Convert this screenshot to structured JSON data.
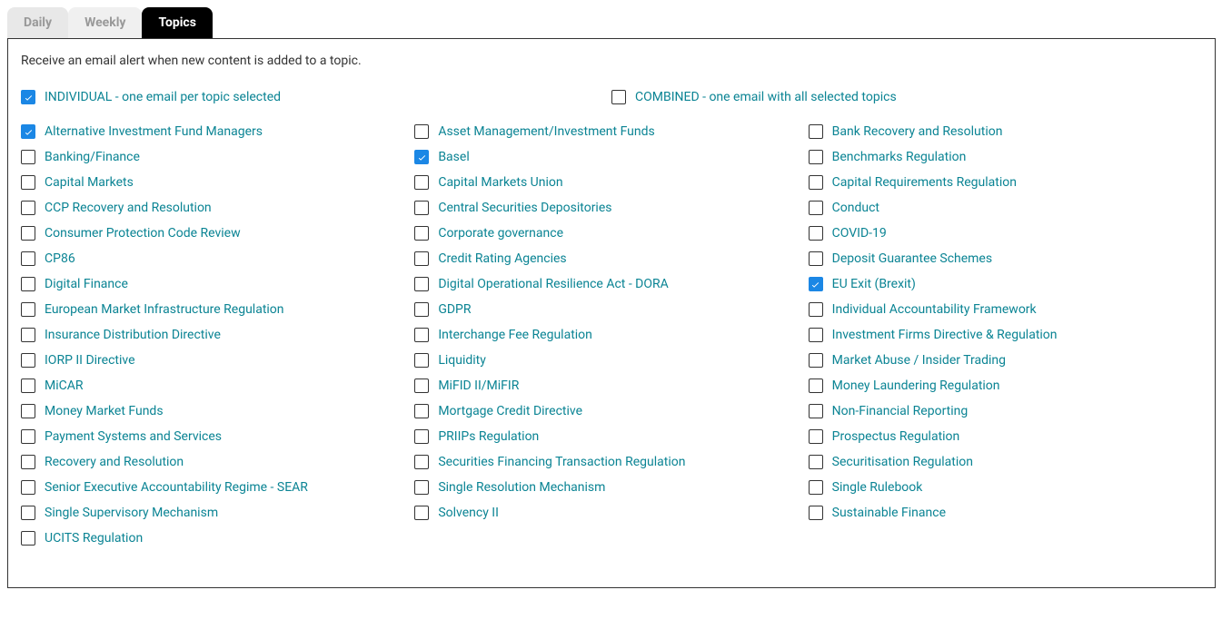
{
  "tabs": {
    "daily": "Daily",
    "weekly": "Weekly",
    "topics": "Topics"
  },
  "intro": "Receive an email alert when new content is added to a topic.",
  "modes": {
    "individual": {
      "label": "INDIVIDUAL - one email per topic selected",
      "checked": true
    },
    "combined": {
      "label": "COMBINED - one email with all selected topics",
      "checked": false
    }
  },
  "topics": [
    {
      "label": "Alternative Investment Fund Managers",
      "checked": true
    },
    {
      "label": "Asset Management/Investment Funds",
      "checked": false
    },
    {
      "label": "Bank Recovery and Resolution",
      "checked": false
    },
    {
      "label": "Banking/Finance",
      "checked": false
    },
    {
      "label": "Basel",
      "checked": true
    },
    {
      "label": "Benchmarks Regulation",
      "checked": false
    },
    {
      "label": "Capital Markets",
      "checked": false
    },
    {
      "label": "Capital Markets Union",
      "checked": false
    },
    {
      "label": "Capital Requirements Regulation",
      "checked": false
    },
    {
      "label": "CCP Recovery and Resolution",
      "checked": false
    },
    {
      "label": "Central Securities Depositories",
      "checked": false
    },
    {
      "label": "Conduct",
      "checked": false
    },
    {
      "label": "Consumer Protection Code Review",
      "checked": false
    },
    {
      "label": "Corporate governance",
      "checked": false
    },
    {
      "label": "COVID-19",
      "checked": false
    },
    {
      "label": "CP86",
      "checked": false
    },
    {
      "label": "Credit Rating Agencies",
      "checked": false
    },
    {
      "label": "Deposit Guarantee Schemes",
      "checked": false
    },
    {
      "label": "Digital Finance",
      "checked": false
    },
    {
      "label": "Digital Operational Resilience Act - DORA",
      "checked": false
    },
    {
      "label": "EU Exit (Brexit)",
      "checked": true
    },
    {
      "label": "European Market Infrastructure Regulation",
      "checked": false
    },
    {
      "label": "GDPR",
      "checked": false
    },
    {
      "label": "Individual Accountability Framework",
      "checked": false
    },
    {
      "label": "Insurance Distribution Directive",
      "checked": false
    },
    {
      "label": "Interchange Fee Regulation",
      "checked": false
    },
    {
      "label": "Investment Firms Directive & Regulation",
      "checked": false
    },
    {
      "label": "IORP II Directive",
      "checked": false
    },
    {
      "label": "Liquidity",
      "checked": false
    },
    {
      "label": "Market Abuse / Insider Trading",
      "checked": false
    },
    {
      "label": "MiCAR",
      "checked": false
    },
    {
      "label": "MiFID II/MiFIR",
      "checked": false
    },
    {
      "label": "Money Laundering Regulation",
      "checked": false
    },
    {
      "label": "Money Market Funds",
      "checked": false
    },
    {
      "label": "Mortgage Credit Directive",
      "checked": false
    },
    {
      "label": "Non-Financial Reporting",
      "checked": false
    },
    {
      "label": "Payment Systems and Services",
      "checked": false
    },
    {
      "label": "PRIIPs Regulation",
      "checked": false
    },
    {
      "label": "Prospectus Regulation",
      "checked": false
    },
    {
      "label": "Recovery and Resolution",
      "checked": false
    },
    {
      "label": "Securities Financing Transaction Regulation",
      "checked": false
    },
    {
      "label": "Securitisation Regulation",
      "checked": false
    },
    {
      "label": "Senior Executive Accountability Regime - SEAR",
      "checked": false
    },
    {
      "label": "Single Resolution Mechanism",
      "checked": false
    },
    {
      "label": "Single Rulebook",
      "checked": false
    },
    {
      "label": "Single Supervisory Mechanism",
      "checked": false
    },
    {
      "label": "Solvency II",
      "checked": false
    },
    {
      "label": "Sustainable Finance",
      "checked": false
    },
    {
      "label": "UCITS Regulation",
      "checked": false
    }
  ]
}
